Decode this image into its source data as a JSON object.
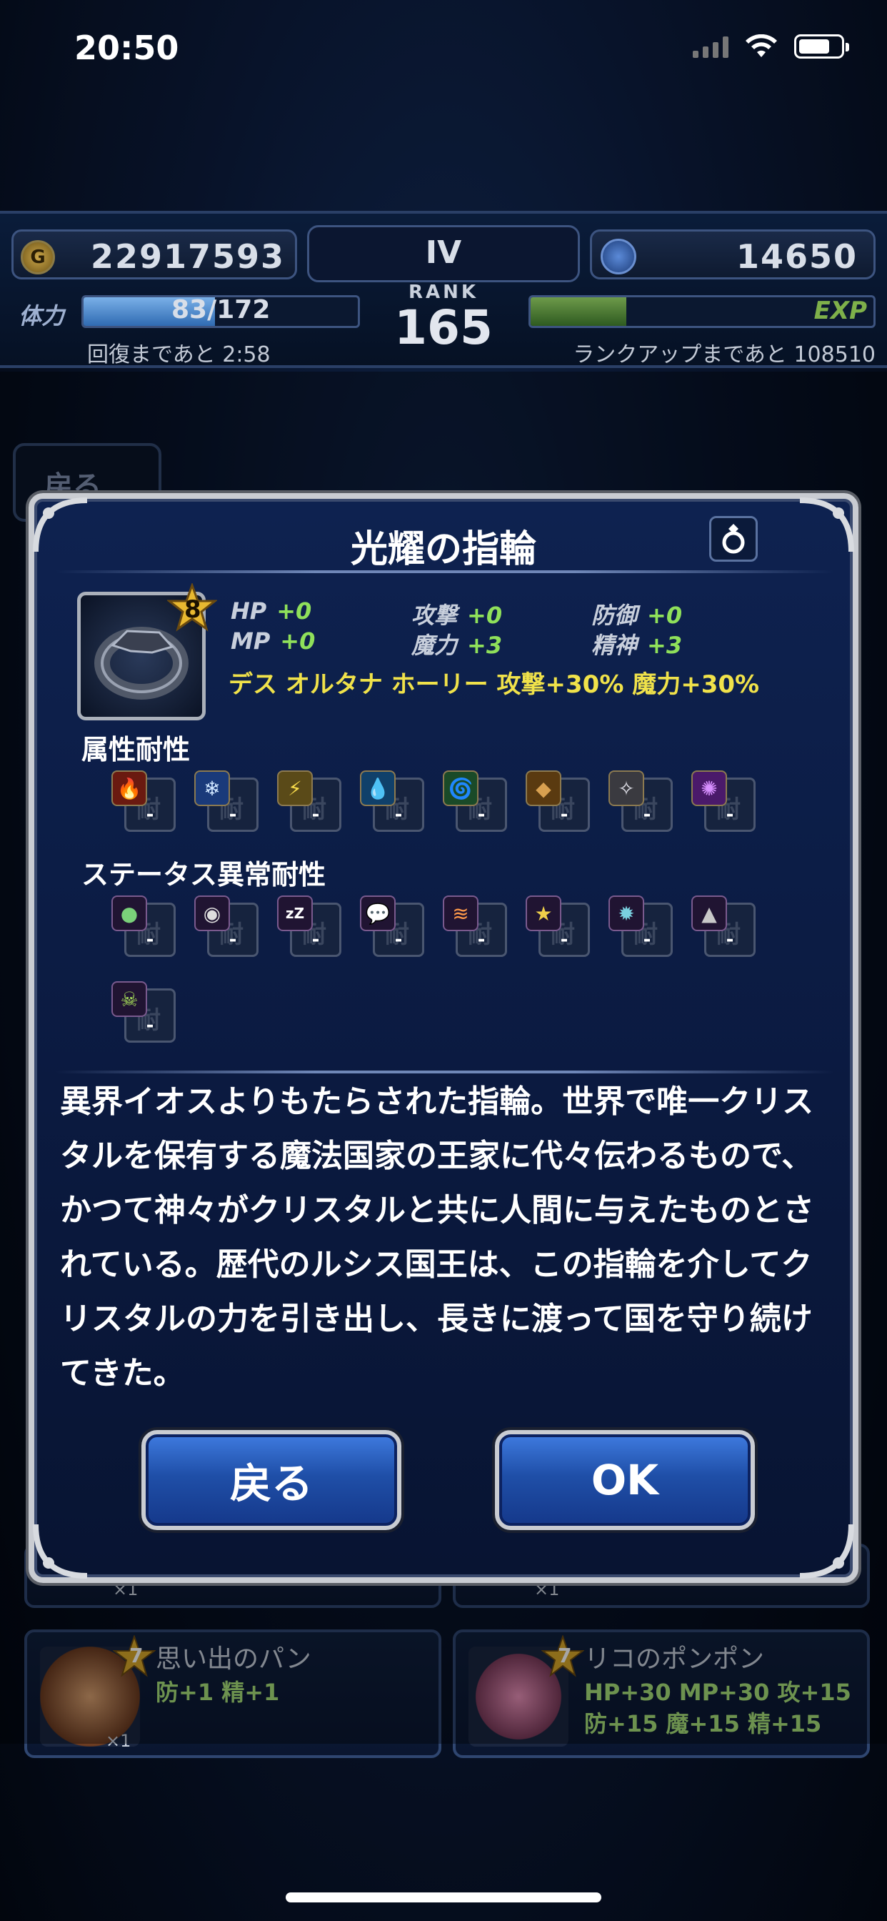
{
  "status_bar": {
    "time": "20:50"
  },
  "header": {
    "gil": "22917593",
    "gems": "14650",
    "rank_roman": "IV",
    "rank_label": "RANK",
    "rank_value": "165",
    "stamina_label": "体力",
    "stamina_value": "83/172",
    "stamina_fraction": 0.48,
    "recover_text": "回復まであと 2:58",
    "exp_label": "EXP",
    "exp_fraction": 0.28,
    "rankup_text": "ランクアップまであと 108510"
  },
  "background": {
    "back_button": "戻る",
    "cards": [
      {
        "title": "思い出のパン",
        "stats": [
          "防+1 精+1"
        ],
        "count": "×1",
        "rarity": "7"
      },
      {
        "title": "リコのポンポン",
        "stats": [
          "HP+30 MP+30 攻+15",
          "防+15 魔+15 精+15"
        ],
        "count": "×1",
        "rarity": "7"
      }
    ],
    "counts_above": [
      "×1",
      "×1"
    ]
  },
  "modal": {
    "title": "光耀の指輪",
    "rarity": "8",
    "stats": {
      "hp_key": "HP",
      "hp_val": "+0",
      "mp_key": "MP",
      "mp_val": "+0",
      "atk_key": "攻撃",
      "atk_val": "+0",
      "mag_key": "魔力",
      "mag_val": "+3",
      "def_key": "防御",
      "def_val": "+0",
      "spr_key": "精神",
      "spr_val": "+3"
    },
    "effects": "デス オルタナ ホーリー 攻撃+30% 魔力+30%",
    "element_label": "属性耐性",
    "status_label": "ステータス異常耐性",
    "resist_bg_char": "耐",
    "resist_value": "-",
    "description": "異界イオスよりもたらされた指輪。世界で唯一クリスタルを保有する魔法国家の王家に代々伝わるもので、かつて神々がクリスタルと共に人間に与えたものとされている。歴代のルシス国王は、この指輪を介してクリスタルの力を引き出し、長きに渡って国を守り続けてきた。",
    "back_button": "戻る",
    "ok_button": "OK"
  },
  "colors": {
    "stat_value": "#8fe05a",
    "effect_text": "#f0e24a",
    "button_blue": "#1f4fa8"
  }
}
